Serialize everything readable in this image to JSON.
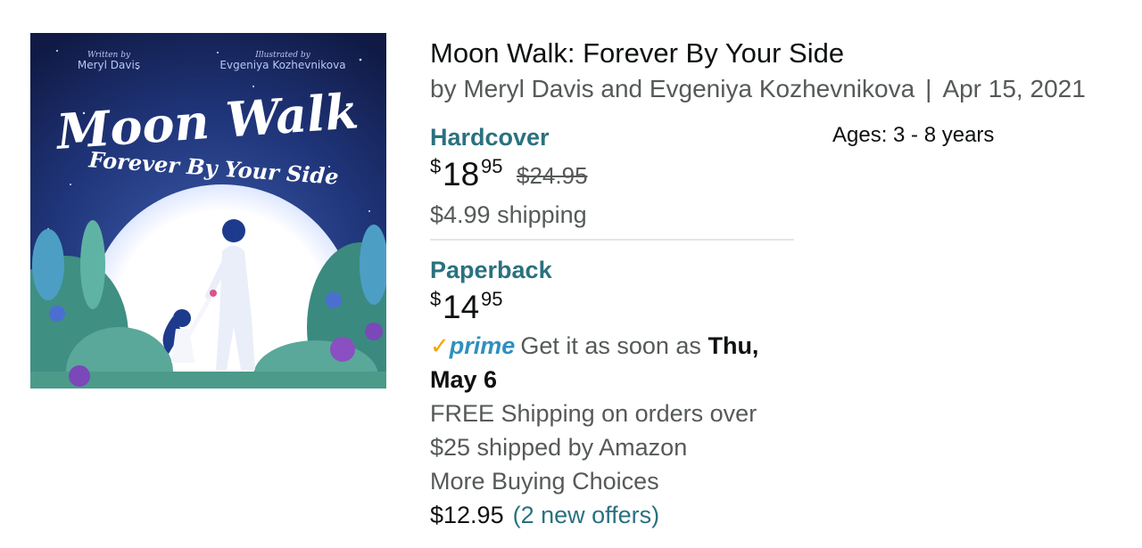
{
  "product": {
    "title": "Moon Walk: Forever By Your Side",
    "byline": "by Meryl Davis and Evgeniya Kozhevnikova",
    "separator": "|",
    "date": "Apr 15, 2021",
    "ages": "Ages: 3 - 8 years"
  },
  "cover": {
    "written_by_label": "Written by",
    "author": "Meryl Davis",
    "illustrated_by_label": "Illustrated by",
    "illustrator": "Evgeniya Kozhevnikova",
    "title_main": "Moon Walk",
    "title_sub": "Forever By Your Side"
  },
  "hardcover": {
    "label": "Hardcover",
    "currency": "$",
    "price_whole": "18",
    "price_fraction": "95",
    "list_price": "$24.95",
    "shipping": "$4.99 shipping"
  },
  "paperback": {
    "label": "Paperback",
    "currency": "$",
    "price_whole": "14",
    "price_fraction": "95",
    "prime_check": "✓",
    "prime_word": "prime",
    "delivery_prefix": "Get it as soon as",
    "delivery_date_1": "Thu,",
    "delivery_date_2": "May 6",
    "free_shipping_1": "FREE Shipping on orders over",
    "free_shipping_2": "$25 shipped by Amazon",
    "more_choices": "More Buying Choices",
    "offer_price": "$12.95",
    "offer_link": "(2 new offers)"
  },
  "colors": {
    "link": "#2a7180",
    "prime_blue": "#2f8fbf",
    "prime_check": "#f7a300",
    "secondary_text": "#565959",
    "cover_sky": "#1d2f6b",
    "cover_moon": "#ffffff"
  }
}
